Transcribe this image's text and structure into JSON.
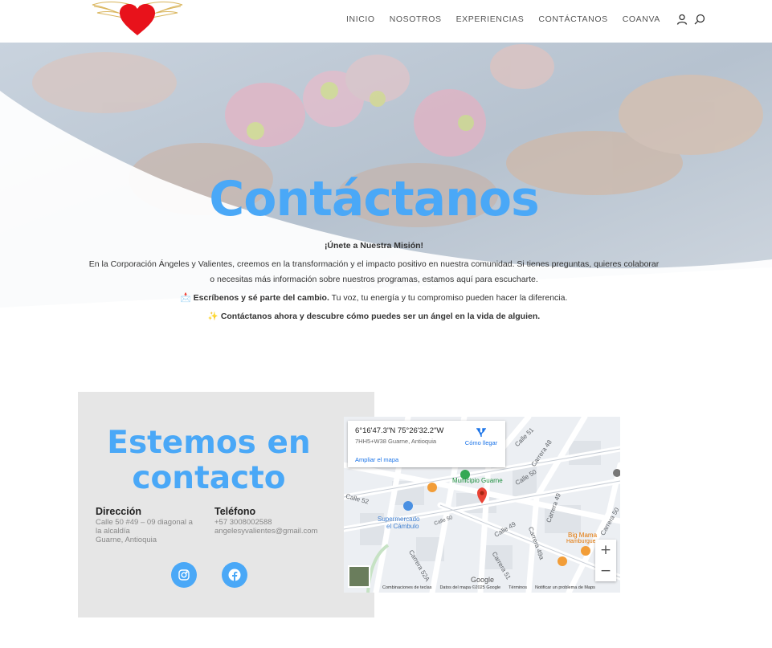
{
  "nav": {
    "items": [
      "INICIO",
      "NOSOTROS",
      "EXPERIENCIAS",
      "CONTÁCTANOS",
      "COANVA"
    ],
    "icons": [
      "user-icon",
      "search-icon"
    ]
  },
  "hero": {
    "title": "Contáctanos",
    "heading": "¡Únete a Nuestra Misión!",
    "paragraph": "En la Corporación Ángeles y Valientes, creemos en la transformación y el impacto positivo en nuestra comunidad. Si tienes preguntas, quieres colaborar o necesitas más información sobre nuestros programas, estamos aquí para escucharte.",
    "line1_emoji": "📩",
    "line1_bold": "Escríbenos y sé parte del cambio.",
    "line1_rest": " Tu voz, tu energía y tu compromiso pueden hacer la diferencia.",
    "line2_emoji": "✨",
    "line2_bold": "Contáctanos ahora y descubre cómo puedes ser un ángel en la vida de alguien."
  },
  "contact": {
    "title_line1": "Estemos en",
    "title_line2": "contacto",
    "address_label": "Dirección",
    "address_line1": "Calle 50 #49 – 09 diagonal a",
    "address_line2": "la alcaldía",
    "address_line3": "Guarne, Antioquia",
    "phone_label": "Teléfono",
    "phone": "+57 3008002588",
    "email": "angelesyvalientes@gmail.com",
    "social": [
      "instagram-icon",
      "facebook-icon"
    ]
  },
  "map": {
    "coords": "6°16'47.3\"N 75°26'32.2\"W",
    "plus_code": "7HH5+W38 Guarne, Antioquia",
    "directions": "Cómo llegar",
    "enlarge": "Ampliar el mapa",
    "labels": {
      "municipio": "Municipio Guarne",
      "super1": "Supermercado",
      "super2": "el Cámbulo",
      "bigmama": "Big Mama",
      "hamburguesa": "Hamburgue",
      "calle50a": "Calle 50",
      "calle50b": "Calle 50",
      "calle49": "Calle 49",
      "calle52": "Calle 52",
      "carrera48": "Carrera 48",
      "carrera49": "Carrera 49",
      "carrera49a": "Carrera 49a",
      "carrera52a": "Carrera 52A",
      "carrera51": "Carrera 51",
      "carrera50": "Carrera 50",
      "calle51": "Calle 51",
      "google": "Google"
    },
    "footer": [
      "Combinaciones de teclas",
      "Datos del mapa ©2025 Google",
      "Términos",
      "Notificar un problema de Maps"
    ],
    "zoom_in": "+",
    "zoom_out": "−"
  }
}
